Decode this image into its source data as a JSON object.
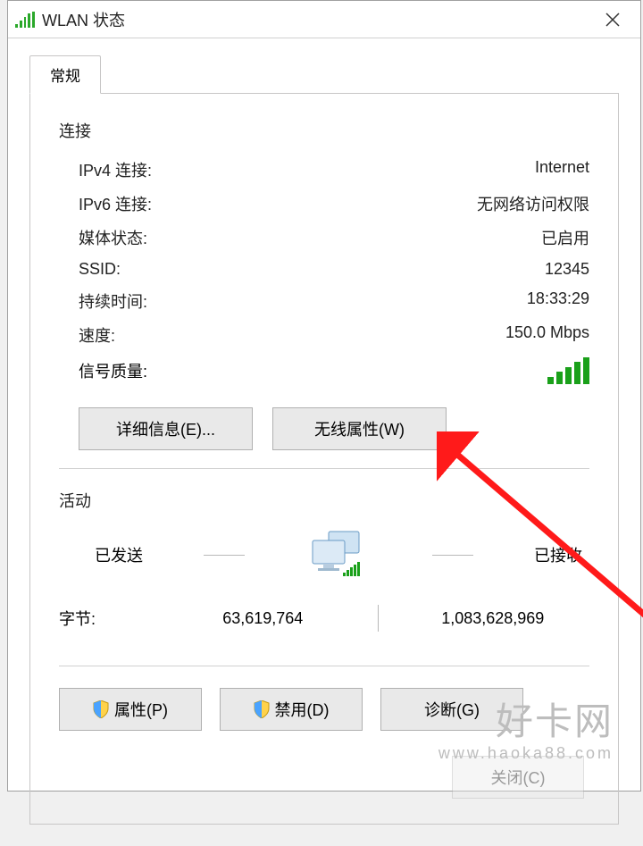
{
  "window": {
    "title": "WLAN 状态"
  },
  "tab": {
    "general": "常规"
  },
  "connection": {
    "section_title": "连接",
    "ipv4_label": "IPv4 连接:",
    "ipv4_value": "Internet",
    "ipv6_label": "IPv6 连接:",
    "ipv6_value": "无网络访问权限",
    "media_label": "媒体状态:",
    "media_value": "已启用",
    "ssid_label": "SSID:",
    "ssid_value": "12345",
    "duration_label": "持续时间:",
    "duration_value": "18:33:29",
    "speed_label": "速度:",
    "speed_value": "150.0 Mbps",
    "signal_label": "信号质量:"
  },
  "buttons": {
    "details": "详细信息(E)...",
    "wireless_props": "无线属性(W)",
    "properties": "属性(P)",
    "disable": "禁用(D)",
    "diagnose": "诊断(G)",
    "close": "关闭(C)"
  },
  "activity": {
    "section_title": "活动",
    "sent_label": "已发送",
    "recv_label": "已接收",
    "bytes_label": "字节:",
    "bytes_sent": "63,619,764",
    "bytes_recv": "1,083,628,969"
  },
  "watermark": {
    "name": "好卡网",
    "url": "www.haoka88.com"
  }
}
